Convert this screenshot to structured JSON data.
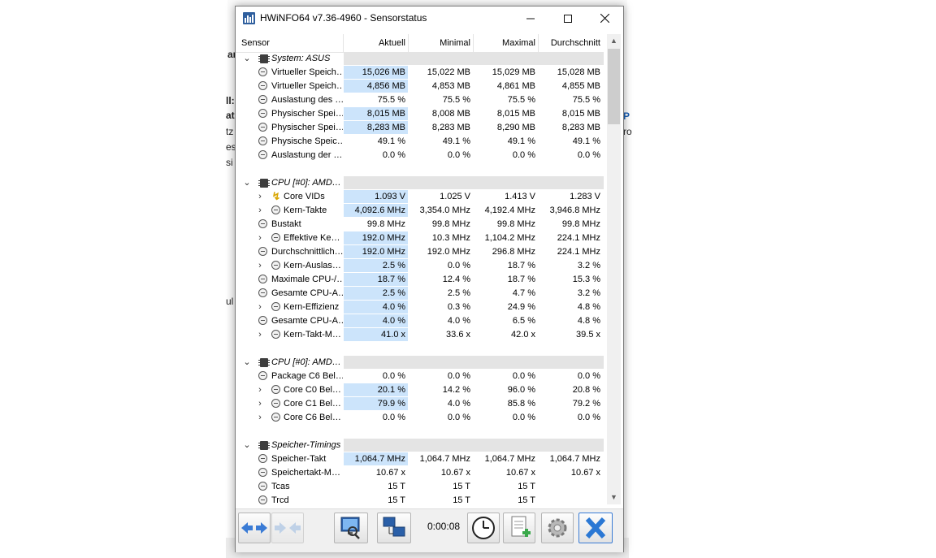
{
  "window": {
    "title": "HWiNFO64 v7.36-4960 - Sensorstatus"
  },
  "columns": {
    "sensor": "Sensor",
    "current": "Aktuell",
    "min": "Minimal",
    "max": "Maximal",
    "avg": "Durchschnitt"
  },
  "background_text": [
    "ar",
    "ll:",
    "at",
    "tz",
    "es",
    "si",
    "ul",
    "P",
    "ro"
  ],
  "rows": [
    {
      "type": "group",
      "name": "System: ASUS"
    },
    {
      "type": "item",
      "name": "Virtueller Speich…",
      "cur": "15,026 MB",
      "min": "15,022 MB",
      "max": "15,029 MB",
      "avg": "15,028 MB",
      "hl": true
    },
    {
      "type": "item",
      "name": "Virtueller Speich…",
      "cur": "4,856 MB",
      "min": "4,853 MB",
      "max": "4,861 MB",
      "avg": "4,855 MB",
      "hl": true
    },
    {
      "type": "item",
      "name": "Auslastung des …",
      "cur": "75.5 %",
      "min": "75.5 %",
      "max": "75.5 %",
      "avg": "75.5 %"
    },
    {
      "type": "item",
      "name": "Physischer Spei…",
      "cur": "8,015 MB",
      "min": "8,008 MB",
      "max": "8,015 MB",
      "avg": "8,015 MB",
      "hl": true
    },
    {
      "type": "item",
      "name": "Physischer Spei…",
      "cur": "8,283 MB",
      "min": "8,283 MB",
      "max": "8,290 MB",
      "avg": "8,283 MB",
      "hl": true
    },
    {
      "type": "item",
      "name": "Physische Speic…",
      "cur": "49.1 %",
      "min": "49.1 %",
      "max": "49.1 %",
      "avg": "49.1 %"
    },
    {
      "type": "item",
      "name": "Auslastung der …",
      "cur": "0.0 %",
      "min": "0.0 %",
      "max": "0.0 %",
      "avg": "0.0 %"
    },
    {
      "type": "blank"
    },
    {
      "type": "group",
      "name": "CPU [#0]: AMD…"
    },
    {
      "type": "item",
      "name": "Core VIDs",
      "cur": "1.093 V",
      "min": "1.025 V",
      "max": "1.413 V",
      "avg": "1.283 V",
      "hl": true,
      "expand": true,
      "icon": "voltage"
    },
    {
      "type": "item",
      "name": "Kern-Takte",
      "cur": "4,092.6 MHz",
      "min": "3,354.0 MHz",
      "max": "4,192.4 MHz",
      "avg": "3,946.8 MHz",
      "hl": true,
      "expand": true
    },
    {
      "type": "item",
      "name": "Bustakt",
      "cur": "99.8 MHz",
      "min": "99.8 MHz",
      "max": "99.8 MHz",
      "avg": "99.8 MHz"
    },
    {
      "type": "item",
      "name": "Effektive Ke…",
      "cur": "192.0 MHz",
      "min": "10.3 MHz",
      "max": "1,104.2 MHz",
      "avg": "224.1 MHz",
      "hl": true,
      "expand": true
    },
    {
      "type": "item",
      "name": "Durchschnittlich…",
      "cur": "192.0 MHz",
      "min": "192.0 MHz",
      "max": "296.8 MHz",
      "avg": "224.1 MHz",
      "hl": true
    },
    {
      "type": "item",
      "name": "Kern-Auslas…",
      "cur": "2.5 %",
      "min": "0.0 %",
      "max": "18.7 %",
      "avg": "3.2 %",
      "hl": true,
      "expand": true
    },
    {
      "type": "item",
      "name": "Maximale CPU-/…",
      "cur": "18.7 %",
      "min": "12.4 %",
      "max": "18.7 %",
      "avg": "15.3 %",
      "hl": true
    },
    {
      "type": "item",
      "name": "Gesamte CPU-A…",
      "cur": "2.5 %",
      "min": "2.5 %",
      "max": "4.7 %",
      "avg": "3.2 %",
      "hl": true
    },
    {
      "type": "item",
      "name": "Kern-Effizienz",
      "cur": "4.0 %",
      "min": "0.3 %",
      "max": "24.9 %",
      "avg": "4.8 %",
      "hl": true,
      "expand": true
    },
    {
      "type": "item",
      "name": "Gesamte CPU-A…",
      "cur": "4.0 %",
      "min": "4.0 %",
      "max": "6.5 %",
      "avg": "4.8 %",
      "hl": true
    },
    {
      "type": "item",
      "name": "Kern-Takt-M…",
      "cur": "41.0 x",
      "min": "33.6 x",
      "max": "42.0 x",
      "avg": "39.5 x",
      "hl": true,
      "expand": true
    },
    {
      "type": "blank"
    },
    {
      "type": "group",
      "name": "CPU [#0]: AMD…"
    },
    {
      "type": "item",
      "name": "Package C6 Bel…",
      "cur": "0.0 %",
      "min": "0.0 %",
      "max": "0.0 %",
      "avg": "0.0 %"
    },
    {
      "type": "item",
      "name": "Core C0 Bel…",
      "cur": "20.1 %",
      "min": "14.2 %",
      "max": "96.0 %",
      "avg": "20.8 %",
      "hl": true,
      "expand": true
    },
    {
      "type": "item",
      "name": "Core C1 Bel…",
      "cur": "79.9 %",
      "min": "4.0 %",
      "max": "85.8 %",
      "avg": "79.2 %",
      "hl": true,
      "expand": true
    },
    {
      "type": "item",
      "name": "Core C6 Bel…",
      "cur": "0.0 %",
      "min": "0.0 %",
      "max": "0.0 %",
      "avg": "0.0 %",
      "expand": true
    },
    {
      "type": "blank"
    },
    {
      "type": "group",
      "name": "Speicher-Timings"
    },
    {
      "type": "item",
      "name": "Speicher-Takt",
      "cur": "1,064.7 MHz",
      "min": "1,064.7 MHz",
      "max": "1,064.7 MHz",
      "avg": "1,064.7 MHz",
      "hl": true
    },
    {
      "type": "item",
      "name": "Speichertakt-M…",
      "cur": "10.67 x",
      "min": "10.67 x",
      "max": "10.67 x",
      "avg": "10.67 x"
    },
    {
      "type": "item",
      "name": "Tcas",
      "cur": "15 T",
      "min": "15 T",
      "max": "15 T",
      "avg": ""
    },
    {
      "type": "item",
      "name": "Trcd",
      "cur": "15 T",
      "min": "15 T",
      "max": "15 T",
      "avg": ""
    }
  ],
  "toolbar": {
    "elapsed": "0:00:08"
  }
}
